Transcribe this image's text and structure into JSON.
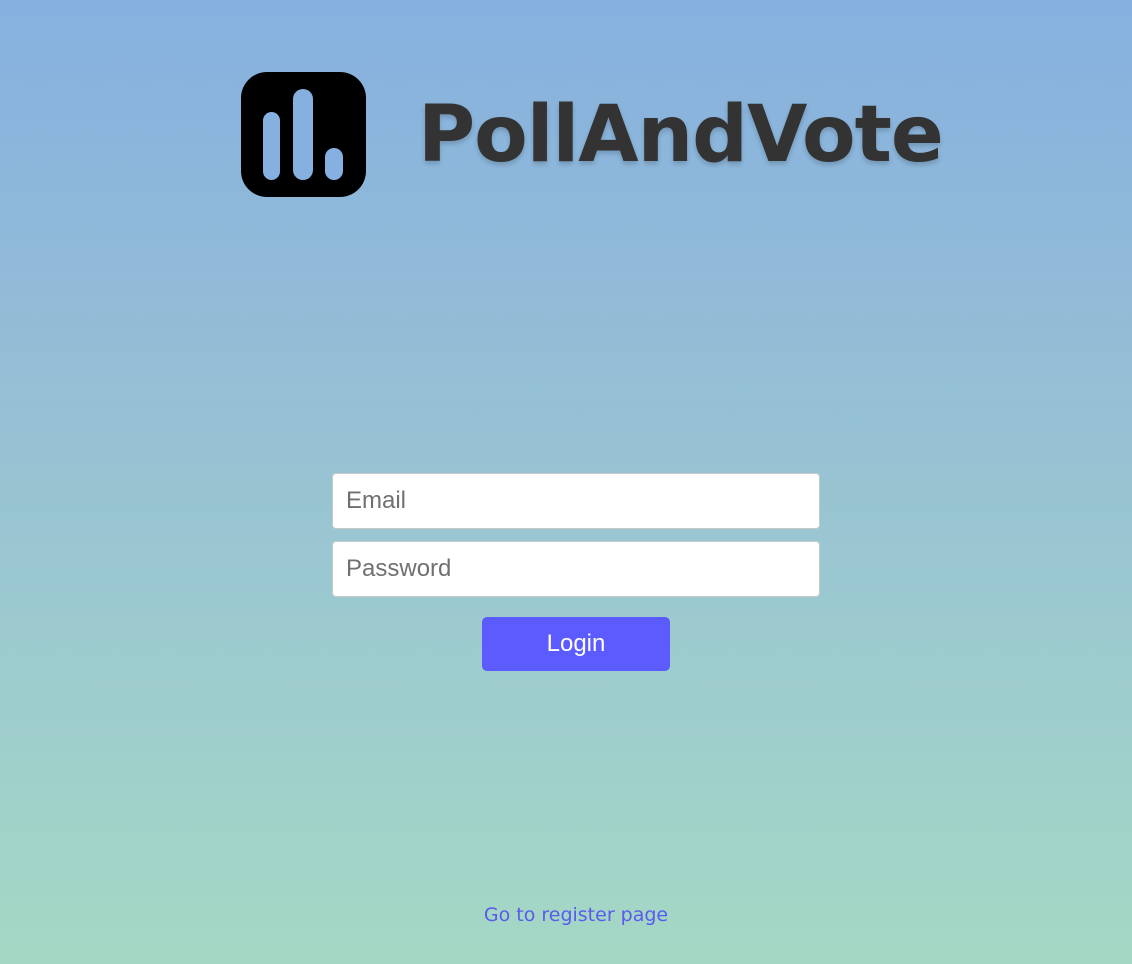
{
  "brand": {
    "title": "PollAndVote",
    "logo_icon": "bar-chart-icon"
  },
  "form": {
    "email_placeholder": "Email",
    "email_value": "",
    "password_placeholder": "Password",
    "password_value": "",
    "login_label": "Login"
  },
  "footer": {
    "register_link": "Go to register page"
  },
  "colors": {
    "accent": "#5b5bff",
    "link": "#5a5aee",
    "title": "#333333",
    "gradient_top": "#86b0df",
    "gradient_bottom": "#a5d8c4"
  }
}
